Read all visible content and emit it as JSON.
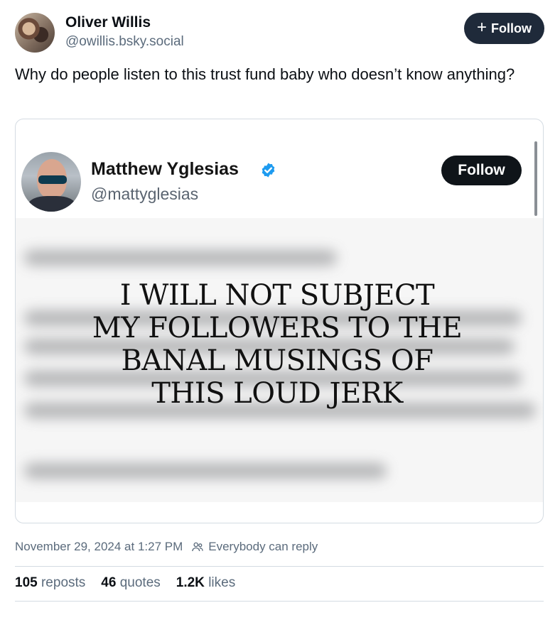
{
  "post": {
    "author": {
      "display_name": "Oliver Willis",
      "handle": "@owillis.bsky.social"
    },
    "follow_label": "Follow",
    "text": "Why do people listen to this trust fund baby who doesn’t know anything?"
  },
  "embed": {
    "author": {
      "display_name": "Matthew Yglesias",
      "handle": "@mattyglesias"
    },
    "follow_label": "Follow",
    "overlay_lines": [
      "I WILL NOT SUBJECT",
      "MY FOLLOWERS TO THE",
      "BANAL MUSINGS OF",
      "THIS LOUD JERK"
    ]
  },
  "meta": {
    "timestamp": "November 29, 2024 at 1:27 PM",
    "reply_setting": "Everybody can reply"
  },
  "stats": {
    "reposts_count": "105",
    "reposts_label": "reposts",
    "quotes_count": "46",
    "quotes_label": "quotes",
    "likes_count": "1.2K",
    "likes_label": "likes"
  },
  "colors": {
    "follow_button_bg": "#1f2a3a",
    "verified_badge": "#1d9bf0",
    "muted_text": "#5b6b7c"
  }
}
